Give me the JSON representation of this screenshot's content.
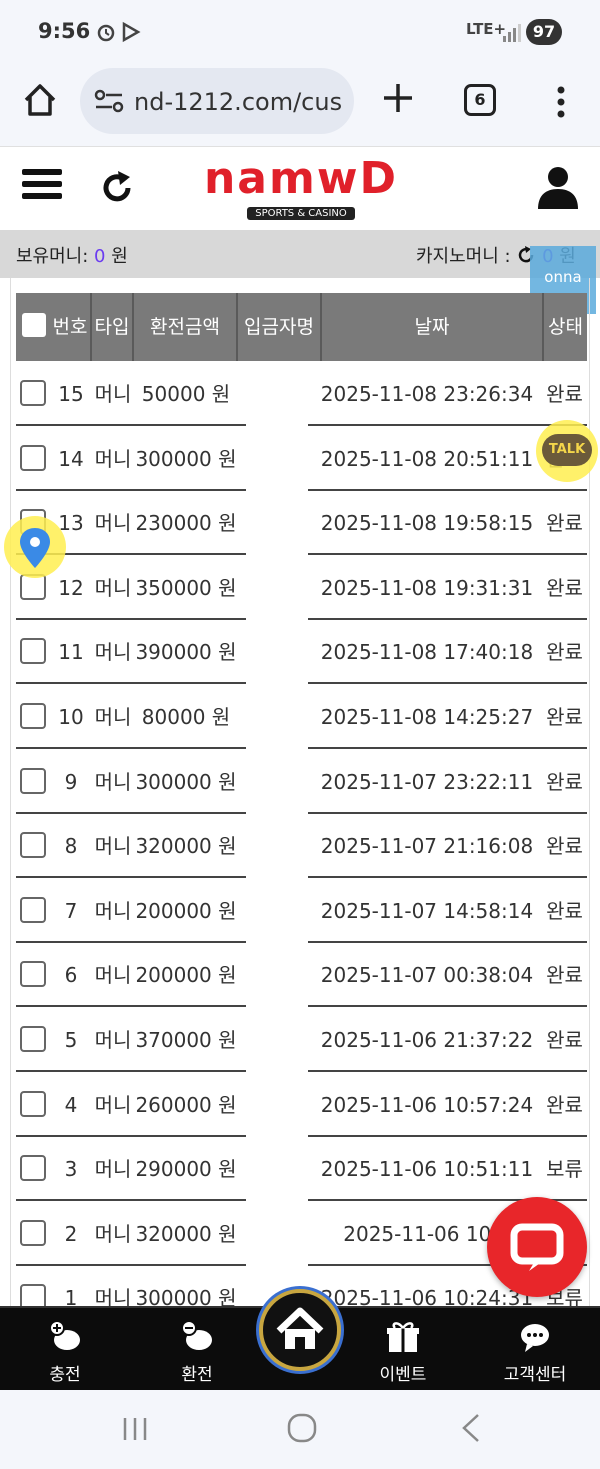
{
  "status": {
    "time": "9:56",
    "network": "LTE+",
    "battery": "97"
  },
  "browser": {
    "url": "nd-1212.com/cus",
    "tab_count": "6"
  },
  "site": {
    "logo": "namwD",
    "logo_sub": "SPORTS & CASINO"
  },
  "money": {
    "holding_label": "보유머니:",
    "holding_value": "0",
    "holding_unit": "원",
    "casino_label": "카지노머니 :",
    "casino_value": "0",
    "casino_unit": "원",
    "onna_label": "onna"
  },
  "table": {
    "headers": [
      "번호",
      "타입",
      "환전금액",
      "입금자명",
      "날짜",
      "상태"
    ],
    "rows": [
      {
        "no": "15",
        "type": "머니",
        "amount": "50000 원",
        "date": "2025-11-08 23:26:34",
        "status": "완료"
      },
      {
        "no": "14",
        "type": "머니",
        "amount": "300000 원",
        "date": "2025-11-08 20:51:11",
        "status": "완료"
      },
      {
        "no": "13",
        "type": "머니",
        "amount": "230000 원",
        "date": "2025-11-08 19:58:15",
        "status": "완료"
      },
      {
        "no": "12",
        "type": "머니",
        "amount": "350000 원",
        "date": "2025-11-08 19:31:31",
        "status": "완료"
      },
      {
        "no": "11",
        "type": "머니",
        "amount": "390000 원",
        "date": "2025-11-08 17:40:18",
        "status": "완료"
      },
      {
        "no": "10",
        "type": "머니",
        "amount": "80000 원",
        "date": "2025-11-08 14:25:27",
        "status": "완료"
      },
      {
        "no": "9",
        "type": "머니",
        "amount": "300000 원",
        "date": "2025-11-07 23:22:11",
        "status": "완료"
      },
      {
        "no": "8",
        "type": "머니",
        "amount": "320000 원",
        "date": "2025-11-07 21:16:08",
        "status": "완료"
      },
      {
        "no": "7",
        "type": "머니",
        "amount": "200000 원",
        "date": "2025-11-07 14:58:14",
        "status": "완료"
      },
      {
        "no": "6",
        "type": "머니",
        "amount": "200000 원",
        "date": "2025-11-07 00:38:04",
        "status": "완료"
      },
      {
        "no": "5",
        "type": "머니",
        "amount": "370000 원",
        "date": "2025-11-06 21:37:22",
        "status": "완료"
      },
      {
        "no": "4",
        "type": "머니",
        "amount": "260000 원",
        "date": "2025-11-06 10:57:24",
        "status": "완료"
      },
      {
        "no": "3",
        "type": "머니",
        "amount": "290000 원",
        "date": "2025-11-06 10:51:11",
        "status": "보류"
      },
      {
        "no": "2",
        "type": "머니",
        "amount": "320000 원",
        "date": "2025-11-06 10:4",
        "status": ""
      },
      {
        "no": "1",
        "type": "머니",
        "amount": "300000 원",
        "date": "2025-11-06 10:24:31",
        "status": "보류"
      }
    ]
  },
  "widgets": {
    "talk_label": "TALK"
  },
  "bottom_nav": {
    "charge": "충전",
    "exchange": "환전",
    "event": "이벤트",
    "support": "고객센터"
  },
  "colors": {
    "brand_red": "#e0202a",
    "money_accent": "#6b3cf0",
    "header_gray": "#7a7a7a"
  }
}
